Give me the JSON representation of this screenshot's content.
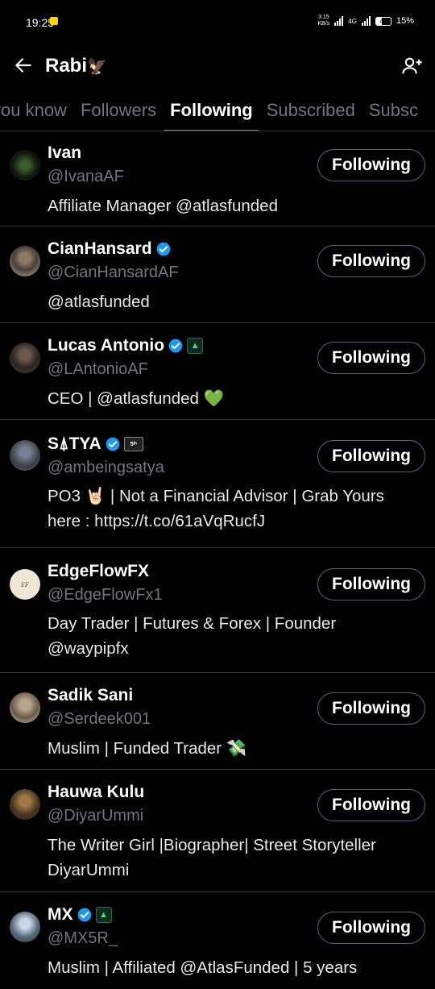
{
  "status_bar": {
    "time": "19:25",
    "data_rate_top": "3.15",
    "data_rate_bottom": "KB/s",
    "network": "4G",
    "battery_level": "42",
    "battery_text": "15%"
  },
  "header": {
    "title": "Rabi",
    "title_emoji": "🦅"
  },
  "tabs": [
    {
      "label": "you know"
    },
    {
      "label": "Followers"
    },
    {
      "label": "Following"
    },
    {
      "label": "Subscribed"
    },
    {
      "label": "Subsc"
    }
  ],
  "active_tab": "Following",
  "button_label": "Following",
  "users": [
    {
      "name": "Ivan",
      "handle": "@IvanaAF",
      "bio1": "Affiliate Manager @atlasfunded",
      "bio2": ""
    },
    {
      "name": "CianHansard",
      "handle": "@CianHansardAF",
      "bio1": "@atlasfunded",
      "bio2": ""
    },
    {
      "name": "Lucas Antonio",
      "handle": "@LAntonioAF",
      "bio1": "CEO | @atlasfunded 💚",
      "bio2": ""
    },
    {
      "name": "S⍋TYA",
      "handle": "@ambeingsatya",
      "bio1": "PO3 🤘🏻 | Not a Financial Advisor | Grab Yours",
      "bio2": "here : https://t.co/61aVqRucfJ"
    },
    {
      "name": "EdgeFlowFX",
      "handle": "@EdgeFlowFx1",
      "bio1": "Day Trader | Futures & Forex | Founder",
      "bio2": "@waypipfx"
    },
    {
      "name": "Sadik Sani",
      "handle": "@Serdeek001",
      "bio1": "Muslim | Funded Trader 💸",
      "bio2": ""
    },
    {
      "name": "Hauwa Kulu",
      "handle": "@DiyarUmmi",
      "bio1": "The Writer Girl |Biographer| Street Storyteller",
      "bio2": "DiyarUmmi"
    },
    {
      "name": "MX",
      "handle": "@MX5R_",
      "bio1": "Muslim | Affiliated @AtlasFunded | 5 years",
      "bio2": ""
    }
  ],
  "colors": {
    "accent": "#1d9bf0",
    "muted": "#71767b",
    "divider": "#2f3336",
    "affiliate_badge": "#4ade80"
  }
}
